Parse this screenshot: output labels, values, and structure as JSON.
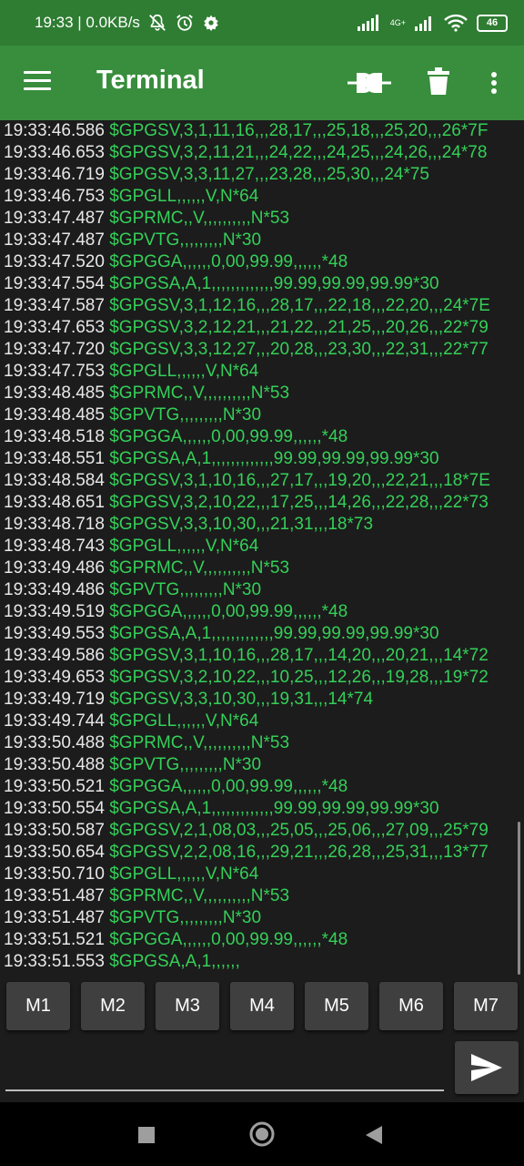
{
  "status_bar": {
    "time_speed": "19:33 | 0.0KB/s",
    "network_label": "4G+",
    "battery_level": "46"
  },
  "app_bar": {
    "title": "Terminal",
    "icons": [
      "menu-icon",
      "connect-icon",
      "delete-icon",
      "more-vert-icon"
    ]
  },
  "colors": {
    "status_bar": "#2e7d32",
    "app_bar": "#388e3c",
    "terminal_bg": "#1c1c1c",
    "timestamp_text": "#e8e8e8",
    "message_text": "#34d058"
  },
  "terminal": {
    "lines": [
      {
        "ts": "19:33:46.586",
        "msg": "$GPGSV,3,1,11,16,,,28,17,,,25,18,,,25,20,,,26*7F"
      },
      {
        "ts": "19:33:46.653",
        "msg": "$GPGSV,3,2,11,21,,,24,22,,,24,25,,,24,26,,,24*78"
      },
      {
        "ts": "19:33:46.719",
        "msg": "$GPGSV,3,3,11,27,,,23,28,,,25,30,,,24*75"
      },
      {
        "ts": "19:33:46.753",
        "msg": "$GPGLL,,,,,,V,N*64"
      },
      {
        "ts": "19:33:47.487",
        "msg": "$GPRMC,,V,,,,,,,,,,N*53"
      },
      {
        "ts": "19:33:47.487",
        "msg": "$GPVTG,,,,,,,,,N*30"
      },
      {
        "ts": "19:33:47.520",
        "msg": "$GPGGA,,,,,,0,00,99.99,,,,,,*48"
      },
      {
        "ts": "19:33:47.554",
        "msg": "$GPGSA,A,1,,,,,,,,,,,,,99.99,99.99,99.99*30"
      },
      {
        "ts": "19:33:47.587",
        "msg": "$GPGSV,3,1,12,16,,,28,17,,,22,18,,,22,20,,,24*7E"
      },
      {
        "ts": "19:33:47.653",
        "msg": "$GPGSV,3,2,12,21,,,21,22,,,21,25,,,20,26,,,22*79"
      },
      {
        "ts": "19:33:47.720",
        "msg": "$GPGSV,3,3,12,27,,,20,28,,,23,30,,,22,31,,,22*77"
      },
      {
        "ts": "19:33:47.753",
        "msg": "$GPGLL,,,,,,V,N*64"
      },
      {
        "ts": "19:33:48.485",
        "msg": "$GPRMC,,V,,,,,,,,,,N*53"
      },
      {
        "ts": "19:33:48.485",
        "msg": "$GPVTG,,,,,,,,,N*30"
      },
      {
        "ts": "19:33:48.518",
        "msg": "$GPGGA,,,,,,0,00,99.99,,,,,,*48"
      },
      {
        "ts": "19:33:48.551",
        "msg": "$GPGSA,A,1,,,,,,,,,,,,,99.99,99.99,99.99*30"
      },
      {
        "ts": "19:33:48.584",
        "msg": "$GPGSV,3,1,10,16,,,27,17,,,19,20,,,22,21,,,18*7E"
      },
      {
        "ts": "19:33:48.651",
        "msg": "$GPGSV,3,2,10,22,,,17,25,,,14,26,,,22,28,,,22*73"
      },
      {
        "ts": "19:33:48.718",
        "msg": "$GPGSV,3,3,10,30,,,21,31,,,18*73"
      },
      {
        "ts": "19:33:48.743",
        "msg": "$GPGLL,,,,,,V,N*64"
      },
      {
        "ts": "19:33:49.486",
        "msg": "$GPRMC,,V,,,,,,,,,,N*53"
      },
      {
        "ts": "19:33:49.486",
        "msg": "$GPVTG,,,,,,,,,N*30"
      },
      {
        "ts": "19:33:49.519",
        "msg": "$GPGGA,,,,,,0,00,99.99,,,,,,*48"
      },
      {
        "ts": "19:33:49.553",
        "msg": "$GPGSA,A,1,,,,,,,,,,,,,99.99,99.99,99.99*30"
      },
      {
        "ts": "19:33:49.586",
        "msg": "$GPGSV,3,1,10,16,,,28,17,,,14,20,,,20,21,,,14*72"
      },
      {
        "ts": "19:33:49.653",
        "msg": "$GPGSV,3,2,10,22,,,10,25,,,12,26,,,19,28,,,19*72"
      },
      {
        "ts": "19:33:49.719",
        "msg": "$GPGSV,3,3,10,30,,,19,31,,,14*74"
      },
      {
        "ts": "19:33:49.744",
        "msg": "$GPGLL,,,,,,V,N*64"
      },
      {
        "ts": "19:33:50.488",
        "msg": "$GPRMC,,V,,,,,,,,,,N*53"
      },
      {
        "ts": "19:33:50.488",
        "msg": "$GPVTG,,,,,,,,,N*30"
      },
      {
        "ts": "19:33:50.521",
        "msg": "$GPGGA,,,,,,0,00,99.99,,,,,,*48"
      },
      {
        "ts": "19:33:50.554",
        "msg": "$GPGSA,A,1,,,,,,,,,,,,,99.99,99.99,99.99*30"
      },
      {
        "ts": "19:33:50.587",
        "msg": "$GPGSV,2,1,08,03,,,25,05,,,25,06,,,27,09,,,25*79"
      },
      {
        "ts": "19:33:50.654",
        "msg": "$GPGSV,2,2,08,16,,,29,21,,,26,28,,,25,31,,,13*77"
      },
      {
        "ts": "19:33:50.710",
        "msg": "$GPGLL,,,,,,V,N*64"
      },
      {
        "ts": "19:33:51.487",
        "msg": "$GPRMC,,V,,,,,,,,,,N*53"
      },
      {
        "ts": "19:33:51.487",
        "msg": "$GPVTG,,,,,,,,,N*30"
      },
      {
        "ts": "19:33:51.521",
        "msg": "$GPGGA,,,,,,0,00,99.99,,,,,,*48"
      },
      {
        "ts": "19:33:51.553",
        "msg": "$GPGSA,A,1,,,,,,"
      }
    ]
  },
  "macros": [
    "M1",
    "M2",
    "M3",
    "M4",
    "M5",
    "M6",
    "M7"
  ],
  "input": {
    "value": "",
    "placeholder": ""
  },
  "nav": {
    "icons": [
      "recents-icon",
      "home-icon",
      "back-icon"
    ]
  }
}
